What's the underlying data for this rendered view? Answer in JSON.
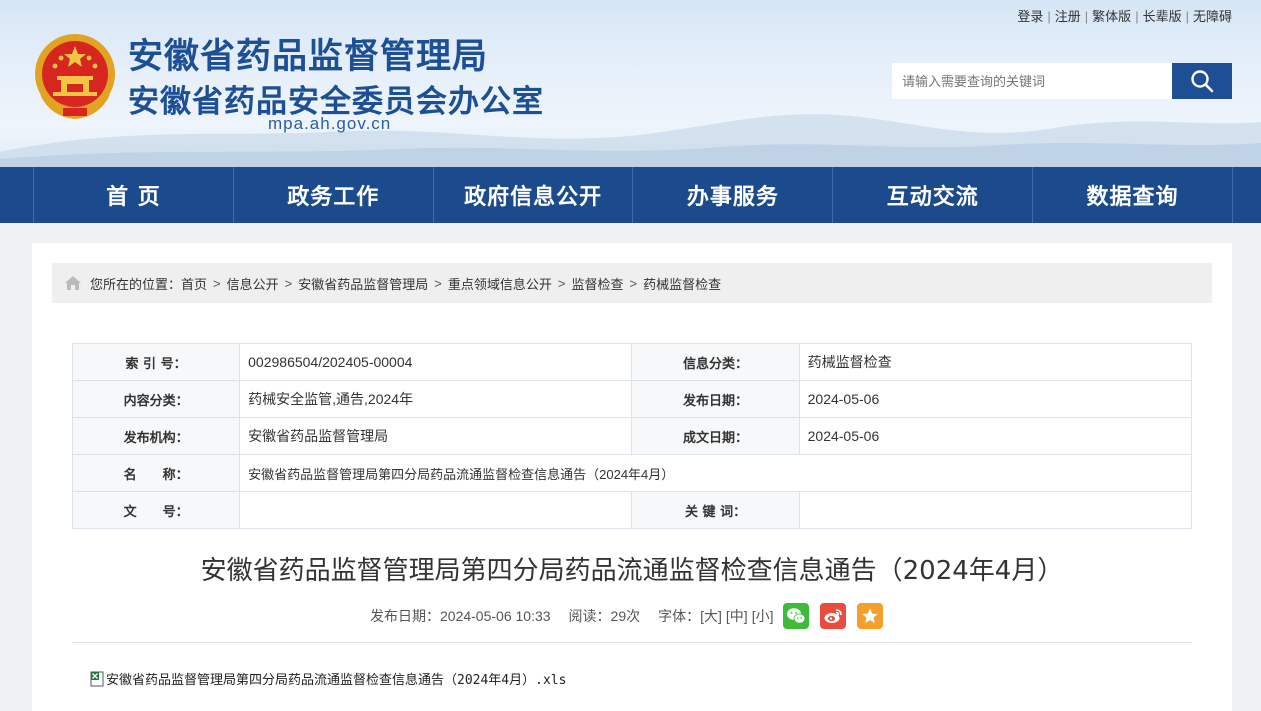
{
  "header": {
    "title_main": "安徽省药品监督管理局",
    "title_sub": "安徽省药品安全委员会办公室",
    "domain": "mpa.ah.gov.cn",
    "top_links": [
      "登录",
      "注册",
      "繁体版",
      "长辈版",
      "无障碍"
    ],
    "search": {
      "placeholder": "请输入需要查询的关键词",
      "icon": "search-icon"
    }
  },
  "nav": {
    "items": [
      "首 页",
      "政务工作",
      "政府信息公开",
      "办事服务",
      "互动交流",
      "数据查询"
    ]
  },
  "breadcrumb": {
    "prefix": "您所在的位置：",
    "items": [
      "首页",
      "信息公开",
      "安徽省药品监督管理局",
      "重点领域信息公开",
      "监督检查",
      "药械监督检查"
    ]
  },
  "meta": {
    "index_label": "索 引 号：",
    "index_value": "002986504/202405-00004",
    "category_label": "信息分类：",
    "category_value": "药械监督检查",
    "content_label": "内容分类：",
    "content_value": "药械安全监管,通告,2024年",
    "publish_date_label": "发布日期：",
    "publish_date_value": "2024-05-06",
    "org_label": "发布机构：",
    "org_value": "安徽省药品监督管理局",
    "written_date_label": "成文日期：",
    "written_date_value": "2024-05-06",
    "name_label": "名　　称：",
    "name_value": "安徽省药品监督管理局第四分局药品流通监督检查信息通告（2024年4月）",
    "doc_no_label": "文　　号：",
    "doc_no_value": "",
    "keywords_label": "关 键 词：",
    "keywords_value": ""
  },
  "article": {
    "title": "安徽省药品监督管理局第四分局药品流通监督检查信息通告（2024年4月）",
    "publish": "发布日期：2024-05-06 10:33",
    "reads": "阅读：29次",
    "font_label": "字体：",
    "font_large": "[大]",
    "font_medium": "[中]",
    "font_small": "[小]",
    "attachment": "安徽省药品监督管理局第四分局药品流通监督检查信息通告（2024年4月）.xls"
  },
  "colors": {
    "brand_blue": "#1b4a8d",
    "title_blue": "#1c4f96",
    "wechat": "#3dbb39",
    "weibo": "#e94b3c",
    "favorite": "#f3a12c"
  }
}
